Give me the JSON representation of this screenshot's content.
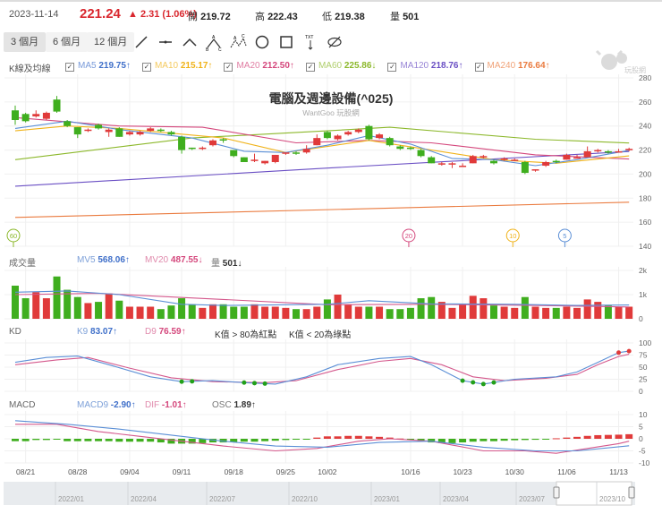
{
  "header": {
    "date": "2023-11-14",
    "price": "221.24",
    "change": "▲ 2.31 (1.06%)",
    "open_label": "開",
    "open": "219.72",
    "high_label": "高",
    "high": "222.43",
    "low_label": "低",
    "low": "219.38",
    "vol_label": "量",
    "vol": "501"
  },
  "tabs": [
    {
      "label": "3 個月",
      "active": true
    },
    {
      "label": "6 個月"
    },
    {
      "label": "12 個月"
    }
  ],
  "tools": [
    "line-tool",
    "horizontal-line-tool",
    "angle-tool",
    "abc-pattern-tool",
    "abcd-pattern-tool",
    "circle-tool",
    "rectangle-tool",
    "text-tool",
    "hide-drawings-tool"
  ],
  "tool_text_label": "TXT",
  "legend": {
    "title": "K線及均線",
    "items": [
      {
        "name": "MA5",
        "value": "219.75↑",
        "color": "#3f6fc9"
      },
      {
        "name": "MA10",
        "value": "215.17↑",
        "color": "#f0b31a"
      },
      {
        "name": "MA20",
        "value": "212.50↑",
        "color": "#d4477c"
      },
      {
        "name": "MA60",
        "value": "225.86↓",
        "color": "#8cb82b"
      },
      {
        "name": "MA120",
        "value": "218.76↑",
        "color": "#6a4fc4"
      },
      {
        "name": "MA240",
        "value": "176.64↑",
        "color": "#ea7a3e"
      }
    ]
  },
  "logo_text": "玩股網",
  "chart_title": "電腦及週邊設備(^025)",
  "chart_subtitle": "WantGoo 玩股網",
  "volume_legend": {
    "title": "成交量",
    "mv5_name": "MV5",
    "mv5": "568.06↑",
    "mv20_name": "MV20",
    "mv20": "487.55↓",
    "vol_name": "量",
    "vol": "501↓"
  },
  "kd_legend": {
    "title": "KD",
    "k_name": "K9",
    "k": "83.07↑",
    "d_name": "D9",
    "d": "76.59↑",
    "note1": "K值 > 80為紅點",
    "note2": "K值 < 20為綠點"
  },
  "macd_legend": {
    "title": "MACD",
    "macd_name": "MACD9",
    "macd": "-2.90↑",
    "dif_name": "DIF",
    "dif": "-1.01↑",
    "osc_name": "OSC",
    "osc": "1.89↑"
  },
  "colors": {
    "up": "#e03a3a",
    "down": "#3fae1e",
    "k": "#5b8fd6",
    "d": "#d4588c"
  },
  "chart_data": {
    "type": "candlestick",
    "price_axis": [
      "280",
      "260",
      "240",
      "220",
      "200",
      "180",
      "160",
      "140"
    ],
    "price_range": [
      140,
      280
    ],
    "volume_axis": [
      "2k",
      "1k",
      "0"
    ],
    "kd_axis": [
      "100",
      "75",
      "50",
      "25",
      "0"
    ],
    "macd_axis": [
      "10",
      "5",
      "0",
      "-5",
      "-10"
    ],
    "date_ticks": [
      "08/21",
      "08/28",
      "09/04",
      "09/11",
      "09/18",
      "09/25",
      "10/02",
      "10/16",
      "10/23",
      "10/30",
      "11/06",
      "11/13"
    ],
    "navigator_labels": [
      "2022/01",
      "2022/04",
      "2022/07",
      "2022/10",
      "2023/01",
      "2023/04",
      "2023/07",
      "2023/10"
    ],
    "ma_markers": [
      "60",
      "20",
      "10",
      "5"
    ],
    "candles": [
      [
        253,
        245,
        257,
        241
      ],
      [
        250,
        244,
        251,
        243
      ],
      [
        248,
        250,
        253,
        247
      ],
      [
        246,
        251,
        252,
        245
      ],
      [
        262,
        252,
        265,
        251
      ],
      [
        244,
        240,
        245,
        239
      ],
      [
        239,
        233,
        239,
        230
      ],
      [
        236,
        237,
        238,
        235
      ],
      [
        241,
        238,
        242,
        237
      ],
      [
        235,
        237,
        238,
        231
      ],
      [
        238,
        231,
        239,
        231
      ],
      [
        233,
        235,
        236,
        232
      ],
      [
        233,
        235,
        236,
        232
      ],
      [
        236,
        238,
        239,
        235
      ],
      [
        237,
        236,
        238,
        235
      ],
      [
        235,
        233,
        236,
        232
      ],
      [
        231,
        220,
        232,
        217
      ],
      [
        222,
        221,
        222,
        220
      ],
      [
        221,
        222,
        223,
        220
      ],
      [
        224,
        228,
        229,
        223
      ],
      [
        229,
        228,
        230,
        226
      ],
      [
        220,
        215,
        220,
        214
      ],
      [
        214,
        210,
        214,
        210
      ],
      [
        211,
        212,
        217,
        210
      ],
      [
        209,
        211,
        211,
        208
      ],
      [
        210,
        216,
        216,
        209
      ],
      [
        217,
        218,
        218,
        216
      ],
      [
        218,
        217,
        219,
        216
      ],
      [
        218,
        221,
        224,
        217
      ],
      [
        224,
        230,
        233,
        224
      ],
      [
        235,
        230,
        236,
        229
      ],
      [
        229,
        232,
        233,
        228
      ],
      [
        233,
        235,
        236,
        232
      ],
      [
        235,
        237,
        238,
        234
      ],
      [
        240,
        229,
        241,
        228
      ],
      [
        230,
        233,
        234,
        229
      ],
      [
        230,
        224,
        231,
        223
      ],
      [
        223,
        221,
        224,
        220
      ],
      [
        222,
        221,
        223,
        220
      ],
      [
        220,
        215,
        221,
        214
      ],
      [
        214,
        209,
        215,
        209
      ],
      [
        208,
        209,
        210,
        207
      ],
      [
        208,
        209,
        210,
        205
      ],
      [
        207,
        207,
        209,
        206
      ],
      [
        209,
        215,
        216,
        209
      ],
      [
        214,
        215,
        216,
        213
      ],
      [
        211,
        209,
        212,
        208
      ],
      [
        212,
        213,
        214,
        211
      ],
      [
        212,
        212,
        213,
        211
      ],
      [
        210,
        201,
        211,
        200
      ],
      [
        203,
        204,
        204,
        202
      ],
      [
        207,
        210,
        211,
        206
      ],
      [
        211,
        210,
        212,
        209
      ],
      [
        212,
        216,
        217,
        212
      ],
      [
        214,
        214,
        216,
        213
      ],
      [
        214,
        219,
        223,
        214
      ],
      [
        219,
        220,
        221,
        218
      ],
      [
        219,
        218,
        220,
        217
      ],
      [
        219,
        219,
        221,
        218
      ],
      [
        220,
        221,
        222,
        219
      ]
    ],
    "ma_lines": {
      "MA5": [
        [
          0,
          238
        ],
        [
          5,
          244
        ],
        [
          10,
          237
        ],
        [
          17,
          230
        ],
        [
          22,
          219
        ],
        [
          26,
          218
        ],
        [
          30,
          224
        ],
        [
          34,
          232
        ],
        [
          38,
          225
        ],
        [
          42,
          213
        ],
        [
          46,
          212
        ],
        [
          50,
          207
        ],
        [
          54,
          212
        ],
        [
          59,
          219.75
        ]
      ],
      "MA10": [
        [
          0,
          236
        ],
        [
          5,
          240
        ],
        [
          10,
          238
        ],
        [
          20,
          230
        ],
        [
          26,
          218
        ],
        [
          34,
          228
        ],
        [
          40,
          220
        ],
        [
          46,
          212
        ],
        [
          52,
          209
        ],
        [
          59,
          215.17
        ]
      ],
      "MA20": [
        [
          0,
          247
        ],
        [
          10,
          240
        ],
        [
          18,
          239
        ],
        [
          27,
          226
        ],
        [
          34,
          228
        ],
        [
          40,
          226
        ],
        [
          50,
          216
        ],
        [
          59,
          212.5
        ]
      ],
      "MA60": [
        [
          0,
          212
        ],
        [
          17,
          230
        ],
        [
          30,
          236
        ],
        [
          36,
          239
        ],
        [
          50,
          229
        ],
        [
          59,
          225.86
        ]
      ],
      "MA120": [
        [
          0,
          190
        ],
        [
          30,
          205
        ],
        [
          59,
          218.76
        ]
      ],
      "MA240": [
        [
          0,
          164
        ],
        [
          59,
          176.64
        ]
      ]
    },
    "volume": [
      1.37,
      0.85,
      1.1,
      0.85,
      1.75,
      1.2,
      0.9,
      0.65,
      0.7,
      1.05,
      0.75,
      0.5,
      0.5,
      0.5,
      0.4,
      0.55,
      0.85,
      0.6,
      0.45,
      0.6,
      0.6,
      0.5,
      0.5,
      0.6,
      0.5,
      0.5,
      0.45,
      0.4,
      0.4,
      0.5,
      0.8,
      1.0,
      0.6,
      0.5,
      0.5,
      0.5,
      0.4,
      0.4,
      0.45,
      0.85,
      0.9,
      0.7,
      0.45,
      0.6,
      0.95,
      0.85,
      0.55,
      0.5,
      0.45,
      0.9,
      0.5,
      0.45,
      0.45,
      0.5,
      0.45,
      0.8,
      0.7,
      0.55,
      0.5,
      0.5
    ],
    "mv5": [
      [
        0,
        1.1
      ],
      [
        5,
        1.15
      ],
      [
        10,
        1.0
      ],
      [
        16,
        0.6
      ],
      [
        20,
        0.55
      ],
      [
        30,
        0.6
      ],
      [
        34,
        0.75
      ],
      [
        40,
        0.62
      ],
      [
        48,
        0.6
      ],
      [
        54,
        0.55
      ],
      [
        59,
        0.57
      ]
    ],
    "mv20": [
      [
        0,
        1.0
      ],
      [
        8,
        1.05
      ],
      [
        20,
        0.8
      ],
      [
        30,
        0.58
      ],
      [
        40,
        0.6
      ],
      [
        50,
        0.55
      ],
      [
        59,
        0.49
      ]
    ],
    "k": [
      [
        0,
        60
      ],
      [
        3,
        70
      ],
      [
        6,
        73
      ],
      [
        9,
        55
      ],
      [
        13,
        30
      ],
      [
        16,
        20
      ],
      [
        19,
        22
      ],
      [
        22,
        18
      ],
      [
        25,
        15
      ],
      [
        28,
        30
      ],
      [
        31,
        55
      ],
      [
        35,
        68
      ],
      [
        38,
        72
      ],
      [
        40,
        55
      ],
      [
        43,
        22
      ],
      [
        45,
        15
      ],
      [
        48,
        25
      ],
      [
        52,
        30
      ],
      [
        54,
        40
      ],
      [
        56,
        60
      ],
      [
        58,
        80
      ],
      [
        59,
        83.07
      ]
    ],
    "d": [
      [
        0,
        55
      ],
      [
        4,
        65
      ],
      [
        7,
        70
      ],
      [
        11,
        48
      ],
      [
        15,
        28
      ],
      [
        19,
        20
      ],
      [
        24,
        18
      ],
      [
        27,
        22
      ],
      [
        31,
        45
      ],
      [
        35,
        62
      ],
      [
        38,
        68
      ],
      [
        41,
        55
      ],
      [
        44,
        30
      ],
      [
        47,
        22
      ],
      [
        51,
        27
      ],
      [
        54,
        35
      ],
      [
        56,
        55
      ],
      [
        58,
        72
      ],
      [
        59,
        76.59
      ]
    ],
    "kd_green_dots": [
      16,
      17,
      22,
      23,
      24,
      43,
      44,
      45,
      46
    ],
    "kd_red_dots": [
      58,
      59
    ],
    "dif": [
      [
        0,
        6
      ],
      [
        4,
        6
      ],
      [
        8,
        3
      ],
      [
        12,
        1
      ],
      [
        16,
        -1
      ],
      [
        20,
        -3
      ],
      [
        25,
        -5
      ],
      [
        29,
        -4
      ],
      [
        33,
        -1
      ],
      [
        36,
        0
      ],
      [
        40,
        -1
      ],
      [
        45,
        -5
      ],
      [
        49,
        -5
      ],
      [
        52,
        -6
      ],
      [
        55,
        -4
      ],
      [
        58,
        -2
      ],
      [
        59,
        -1.01
      ]
    ],
    "macd9": [
      [
        0,
        7.5
      ],
      [
        5,
        6
      ],
      [
        10,
        4
      ],
      [
        15,
        1.5
      ],
      [
        20,
        -1
      ],
      [
        25,
        -3
      ],
      [
        30,
        -3.5
      ],
      [
        35,
        -1.5
      ],
      [
        40,
        -1
      ],
      [
        45,
        -3.5
      ],
      [
        50,
        -5
      ],
      [
        54,
        -5
      ],
      [
        59,
        -2.9
      ]
    ],
    "osc": [
      -1,
      -1,
      -0.5,
      -0.5,
      -0.2,
      -1,
      -1,
      -1,
      -1,
      -1,
      -1.2,
      -1.2,
      -1.2,
      -1.2,
      -1.5,
      -2,
      -2,
      -2,
      -1.8,
      -1.5,
      -1.5,
      -1.4,
      -1.2,
      -1.2,
      -1,
      -0.8,
      -0.5,
      -0.3,
      -0.1,
      0.5,
      1,
      1,
      1.2,
      1.2,
      1,
      0.8,
      0.5,
      0.1,
      -0.3,
      -0.8,
      -1.5,
      -1.8,
      -1.8,
      -1.5,
      -1.2,
      -1,
      -1,
      -0.8,
      -0.6,
      -0.5,
      -0.4,
      -0.2,
      0.2,
      0.5,
      0.8,
      1.2,
      1.5,
      1.6,
      1.7,
      1.89
    ]
  }
}
